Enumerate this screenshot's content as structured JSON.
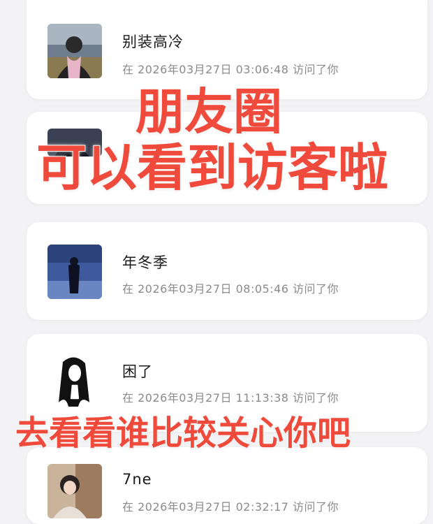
{
  "overlay": {
    "line1": "朋友圈",
    "line2": "可以看到访客啦",
    "line3": "去看看谁比较关心你吧"
  },
  "visitors": [
    {
      "name": "别装高冷",
      "visit": "在 2026年03月27日 03:06:48 访问了你"
    },
    {
      "name": "",
      "visit": ""
    },
    {
      "name": "年冬季",
      "visit": "在 2026年03月27日 08:05:46 访问了你"
    },
    {
      "name": "困了",
      "visit": "在 2026年03月27日 11:13:38 访问了你"
    },
    {
      "name": "7ne",
      "visit": "在 2026年03月27日 02:32:17 访问了你"
    }
  ],
  "colors": {
    "overlay_text": "#ef4a3b",
    "overlay_stroke": "#ffffff"
  }
}
